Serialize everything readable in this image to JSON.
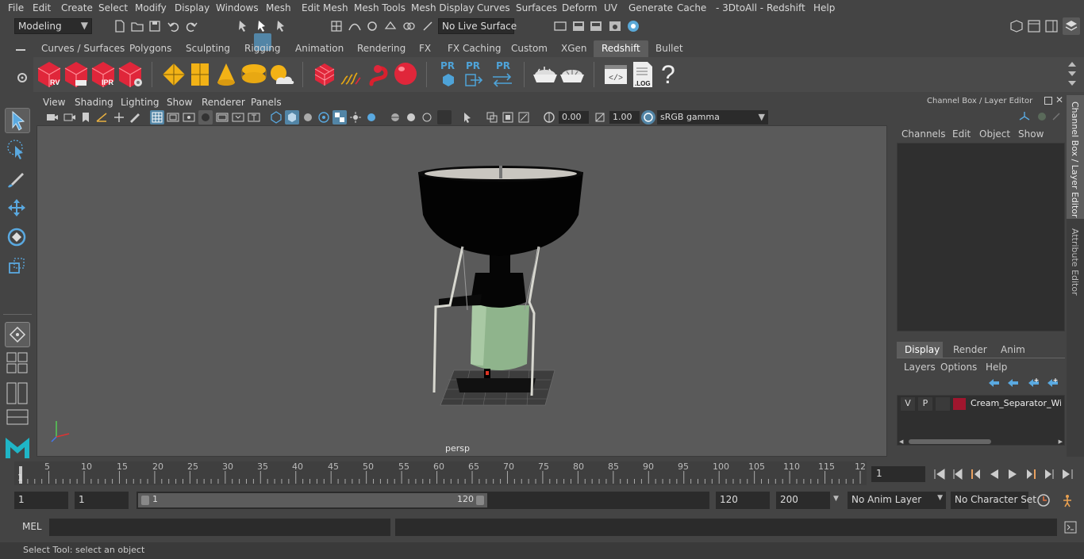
{
  "menubar": {
    "items": [
      "File",
      "Edit",
      "Create",
      "Select",
      "Modify",
      "Display",
      "Windows",
      "Mesh",
      "Edit Mesh",
      "Mesh Tools",
      "Mesh Display",
      "Curves",
      "Surfaces",
      "Deform",
      "UV",
      "Generate",
      "Cache",
      "- 3DtoAll -",
      "Redshift",
      "Help"
    ]
  },
  "statusline": {
    "mode": "Modeling",
    "live_surface": "No Live Surface"
  },
  "shelf": {
    "tabs": [
      "Curves / Surfaces",
      "Polygons",
      "Sculpting",
      "Rigging",
      "Animation",
      "Rendering",
      "FX",
      "FX Caching",
      "Custom",
      "XGen",
      "Redshift",
      "Bullet"
    ],
    "active_tab": "Redshift",
    "icon_labels": {
      "rv": "RV",
      "ipr": "IPR",
      "pr": "PR",
      "log": ".LOG",
      "help": "?"
    }
  },
  "viewport": {
    "menu": [
      "View",
      "Shading",
      "Lighting",
      "Show",
      "Renderer",
      "Panels"
    ],
    "exposure": "0.00",
    "gamma": "1.00",
    "colorspace": "sRGB gamma",
    "camera_label": "persp"
  },
  "channel_box": {
    "title": "Channel Box / Layer Editor",
    "menu": [
      "Channels",
      "Edit",
      "Object",
      "Show"
    ],
    "layer_tabs": [
      "Display",
      "Render",
      "Anim"
    ],
    "active_layer_tab": "Display",
    "layer_menu": [
      "Layers",
      "Options",
      "Help"
    ],
    "layer_row": {
      "v": "V",
      "p": "P",
      "name": "Cream_Separator_With",
      "color": "#a0162e"
    }
  },
  "side_tabs": [
    "Channel Box / Layer Editor",
    "Attribute Editor"
  ],
  "timeline": {
    "ticks": [
      "1",
      "5",
      "10",
      "15",
      "20",
      "25",
      "30",
      "35",
      "40",
      "45",
      "50",
      "55",
      "60",
      "65",
      "70",
      "75",
      "80",
      "85",
      "90",
      "95",
      "100",
      "105",
      "110",
      "115",
      "12"
    ],
    "current_frame": "1"
  },
  "range": {
    "start": "1",
    "playback_start": "1",
    "slider_start": "1",
    "slider_end": "120",
    "playback_end": "120",
    "end": "200",
    "anim_layer": "No Anim Layer",
    "character_set": "No Character Set"
  },
  "command": {
    "label": "MEL"
  },
  "helpline": {
    "text": "Select Tool: select an object"
  },
  "colors": {
    "accent": "#5285a6",
    "viewport_bg": "#5a5a5a",
    "redshift_red": "#e0263a",
    "yellow": "#f2b216",
    "body_green": "#8fb48c"
  }
}
